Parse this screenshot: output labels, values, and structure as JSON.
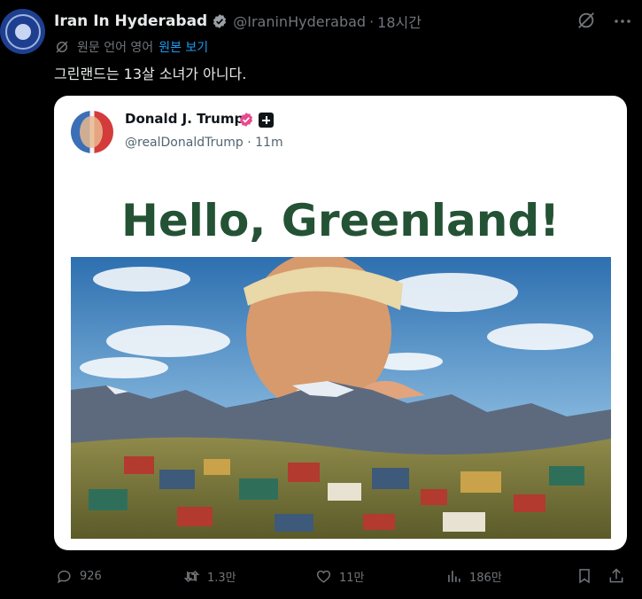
{
  "colors": {
    "background": "#000000",
    "text_primary": "#e7e9ea",
    "text_secondary": "#71767b",
    "link": "#1d9bf0",
    "verified": "#1d9bf0",
    "headline": "#245235",
    "quoted_verified": "#e44b8d"
  },
  "post": {
    "author_name": "Iran In Hyderabad",
    "author_handle": "@IraninHyderabad",
    "separator": "·",
    "timestamp": "18시간",
    "translation_note": "원문 언어 영어",
    "show_original": "원본 보기",
    "text": "그린랜드는 13살 소녀가 아니다."
  },
  "quoted": {
    "author_name": "Donald J. Trump",
    "author_handle": "@realDonaldTrump",
    "separator": "·",
    "timestamp": "11m",
    "headline": "Hello, Greenland!"
  },
  "icons": {
    "avatar": "emblem-avatar",
    "verified": "verified-badge-icon",
    "grok": "grok-icon",
    "more": "more-icon",
    "translate": "translate-icon",
    "reply": "reply-icon",
    "repost": "repost-icon",
    "like": "heart-icon",
    "views": "views-icon",
    "bookmark": "bookmark-icon",
    "share": "share-icon"
  },
  "metrics": {
    "replies": "926",
    "reposts": "1.3만",
    "likes": "11만",
    "views": "186만"
  }
}
